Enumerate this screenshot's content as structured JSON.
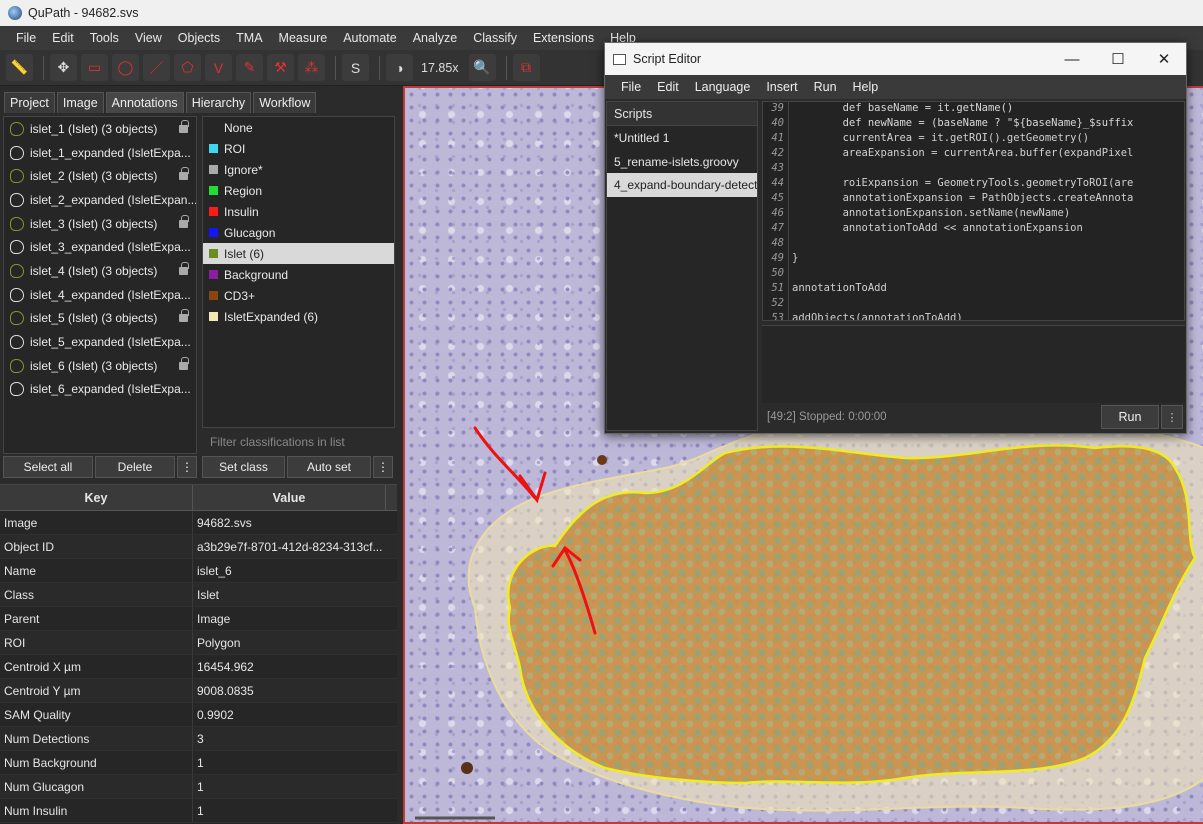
{
  "window": {
    "title": "QuPath - 94682.svs"
  },
  "menu": [
    "File",
    "Edit",
    "Tools",
    "View",
    "Objects",
    "TMA",
    "Measure",
    "Automate",
    "Analyze",
    "Classify",
    "Extensions",
    "Help"
  ],
  "toolbar": {
    "zoom": "17.85x",
    "S_label": "S"
  },
  "tabs": [
    "Project",
    "Image",
    "Annotations",
    "Hierarchy",
    "Workflow"
  ],
  "annotations": [
    {
      "label": "islet_1 (Islet) (3 objects)",
      "locked": true
    },
    {
      "label": "islet_1_expanded (IsletExpa...",
      "locked": false
    },
    {
      "label": "islet_2 (Islet) (3 objects)",
      "locked": true
    },
    {
      "label": "islet_2_expanded (IsletExpan...",
      "locked": false
    },
    {
      "label": "islet_3 (Islet) (3 objects)",
      "locked": true
    },
    {
      "label": "islet_3_expanded (IsletExpa...",
      "locked": false
    },
    {
      "label": "islet_4 (Islet) (3 objects)",
      "locked": true
    },
    {
      "label": "islet_4_expanded (IsletExpa...",
      "locked": false
    },
    {
      "label": "islet_5 (Islet) (3 objects)",
      "locked": true
    },
    {
      "label": "islet_5_expanded (IsletExpa...",
      "locked": false
    },
    {
      "label": "islet_6 (Islet) (3 objects)",
      "locked": true
    },
    {
      "label": "islet_6_expanded (IsletExpa...",
      "locked": false
    }
  ],
  "classes": [
    {
      "label": "None",
      "color": ""
    },
    {
      "label": "ROI",
      "color": "#3fd6f0"
    },
    {
      "label": "Ignore*",
      "color": "#aaaaaa"
    },
    {
      "label": "Region",
      "color": "#22dd33"
    },
    {
      "label": "Insulin",
      "color": "#ff1a1a"
    },
    {
      "label": "Glucagon",
      "color": "#1414ff"
    },
    {
      "label": "Islet (6)",
      "color": "#6b8e23"
    },
    {
      "label": "Background",
      "color": "#8a1ea0"
    },
    {
      "label": "CD3+",
      "color": "#8b4513"
    },
    {
      "label": "IsletExpanded (6)",
      "color": "#f5e6b8"
    }
  ],
  "filter_placeholder": "Filter classifications in list",
  "buttons": {
    "select_all": "Select all",
    "delete": "Delete",
    "more": "⋮",
    "set_class": "Set class",
    "auto_set": "Auto set"
  },
  "table": {
    "headers": [
      "Key",
      "Value"
    ],
    "rows": [
      [
        "Image",
        "94682.svs"
      ],
      [
        "Object ID",
        "a3b29e7f-8701-412d-8234-313cf..."
      ],
      [
        "Name",
        "islet_6"
      ],
      [
        "Class",
        "Islet"
      ],
      [
        "Parent",
        "Image"
      ],
      [
        "ROI",
        "Polygon"
      ],
      [
        "Centroid X µm",
        "16454.962"
      ],
      [
        "Centroid Y µm",
        "9008.0835"
      ],
      [
        "SAM Quality",
        "0.9902"
      ],
      [
        "Num Detections",
        "3"
      ],
      [
        "Num Background",
        "1"
      ],
      [
        "Num Glucagon",
        "1"
      ],
      [
        "Num Insulin",
        "1"
      ]
    ]
  },
  "script_editor": {
    "title": "Script Editor",
    "menu": [
      "File",
      "Edit",
      "Language",
      "Insert",
      "Run",
      "Help"
    ],
    "scripts_header": "Scripts",
    "scripts": [
      "*Untitled 1",
      "5_rename-islets.groovy",
      "4_expand-boundary-detect"
    ],
    "selected_script": 2,
    "code": [
      {
        "n": "39",
        "t": "        def baseName = it.getName()"
      },
      {
        "n": "40",
        "t": "        def newName = (baseName ? \"${baseName}_$suffix"
      },
      {
        "n": "41",
        "t": "        currentArea = it.getROI().getGeometry()"
      },
      {
        "n": "42",
        "t": "        areaExpansion = currentArea.buffer(expandPixel"
      },
      {
        "n": "43",
        "t": ""
      },
      {
        "n": "44",
        "t": "        roiExpansion = GeometryTools.geometryToROI(are"
      },
      {
        "n": "45",
        "t": "        annotationExpansion = PathObjects.createAnnota"
      },
      {
        "n": "46",
        "t": "        annotationExpansion.setName(newName)"
      },
      {
        "n": "47",
        "t": "        annotationToAdd << annotationExpansion"
      },
      {
        "n": "48",
        "t": ""
      },
      {
        "n": "49",
        "t": "}"
      },
      {
        "n": "50",
        "t": ""
      },
      {
        "n": "51",
        "t": "annotationToAdd"
      },
      {
        "n": "52",
        "t": ""
      },
      {
        "n": "53",
        "t": "addObjects(annotationToAdd)"
      }
    ],
    "status": "[49:2]    Stopped: 0:00:00",
    "run_label": "Run"
  }
}
